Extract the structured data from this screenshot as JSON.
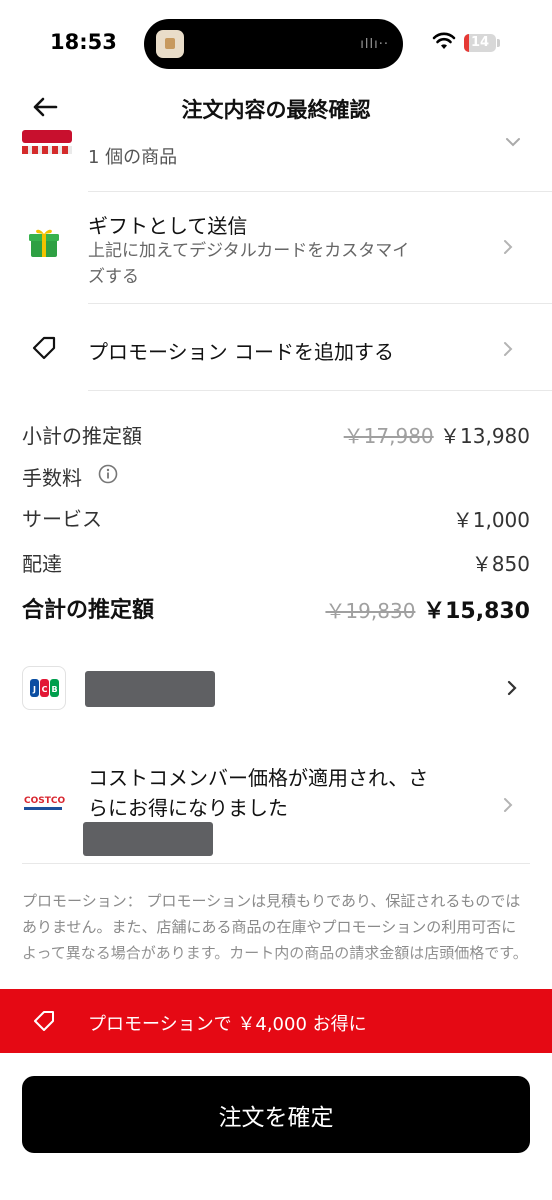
{
  "status_bar": {
    "time": "18:53",
    "battery": "14"
  },
  "header": {
    "title": "注文内容の最終確認"
  },
  "cart": {
    "count_text": "1 個の商品"
  },
  "gift": {
    "title": "ギフトとして送信",
    "subtitle_line1": "上記に加えてデジタルカードをカスタマイ",
    "subtitle_line2": "ズする"
  },
  "promo_code": {
    "label": "プロモーション コードを追加する"
  },
  "prices": {
    "subtotal_label": "小計の推定額",
    "subtotal_original": "￥17,980",
    "subtotal": "￥13,980",
    "fees_label": "手数料",
    "service_label": "サービス",
    "service": "￥1,000",
    "delivery_label": "配達",
    "delivery": "￥850",
    "total_label": "合計の推定額",
    "total_original": "￥19,830",
    "total": "￥15,830"
  },
  "payment": {
    "card_brand": "JCB"
  },
  "membership": {
    "logo_text": "COSTCO",
    "line1": "コストコメンバー価格が適用され、さ",
    "line2": "らにお得になりました"
  },
  "disclaimer": "プロモーション： プロモーションは見積もりであり、保証されるものではありません。また、店舗にある商品の在庫やプロモーションの利用可否によって異なる場合があります。カート内の商品の請求金額は店頭価格です。",
  "promo_banner": {
    "text": "プロモーションで ￥4,000 お得に"
  },
  "confirm_button": {
    "label": "注文を確定"
  },
  "colors": {
    "promo_red": "#e50914",
    "button_black": "#000000"
  }
}
